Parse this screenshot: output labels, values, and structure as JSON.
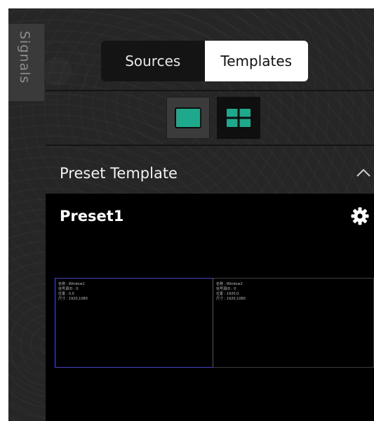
{
  "sidebar": {
    "tab_label": "Signals"
  },
  "tabs": {
    "sources_label": "Sources",
    "templates_label": "Templates",
    "active": "Templates"
  },
  "view_modes": [
    {
      "name": "single-view",
      "icon": "single-screen-icon"
    },
    {
      "name": "grid-view",
      "icon": "quad-grid-icon"
    }
  ],
  "section": {
    "title": "Preset Template",
    "expanded": true
  },
  "preset": {
    "name": "Preset1",
    "windows": [
      {
        "name_line": "名称 : Window1",
        "id_line": "信号源ID : 0",
        "position_line": "位置 : 0,0",
        "size_line": "尺寸 : 1920,1080"
      },
      {
        "name_line": "名称 : Window2",
        "id_line": "信号源ID : 0",
        "position_line": "位置 : 1920,0",
        "size_line": "尺寸 : 1920,1080"
      }
    ]
  },
  "colors": {
    "accent": "#1fa98c",
    "selected_window_border": "#4b45c2",
    "panel_bg": "#262626"
  }
}
